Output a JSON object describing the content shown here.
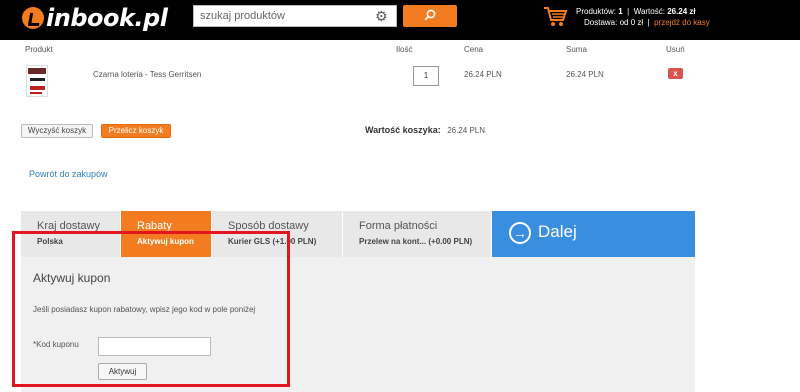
{
  "header": {
    "logo_text": "inbook.pl",
    "search_placeholder": "szukaj produktów",
    "cart": {
      "products_label": "Produktów:",
      "products_count": "1",
      "value_label": "Wartość:",
      "value": "26.24 zł",
      "shipping_label": "Dostawa: od 0 zł",
      "checkout_link": "przejdź do kasy"
    }
  },
  "table": {
    "columns": [
      "Produkt",
      "Ilość",
      "Cena",
      "Suma",
      "Usuń"
    ],
    "rows": [
      {
        "title": "Czarna loteria - Tess Gerritsen",
        "qty": "1",
        "price": "26.24 PLN",
        "sum": "26.24 PLN",
        "remove": "x"
      }
    ]
  },
  "actions": {
    "clear_label": "Wyczyść koszyk",
    "recalc_label": "Przelicz koszyk",
    "total_label": "Wartość koszyka:",
    "total_value": "26.24 PLN"
  },
  "back_link": "Powrót do zakupów",
  "steps": [
    {
      "title": "Kraj dostawy",
      "sub": "Polska"
    },
    {
      "title": "Rabaty",
      "sub": "Aktywuj kupon"
    },
    {
      "title": "Sposób dostawy",
      "sub": "Kurier GLS (+1.00 PLN)"
    },
    {
      "title": "Forma płatności",
      "sub": "Przelew na kont... (+0.00 PLN)"
    }
  ],
  "next_label": "Dalej",
  "coupon": {
    "title": "Aktywuj kupon",
    "description": "Jeśli posiadasz kupon rabatowy, wpisz jego kod w pole poniżej",
    "code_label": "*Kod kuponu",
    "button_label": "Aktywuj"
  },
  "colors": {
    "brand": "#f47c20",
    "next": "#3a8ee0",
    "highlight": "#e3151e",
    "header_bg": "#000000"
  }
}
